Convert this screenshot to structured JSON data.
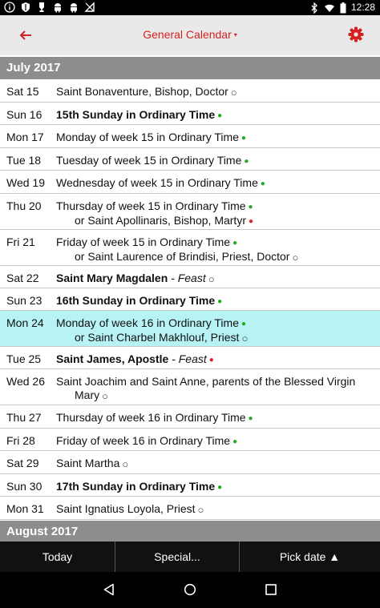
{
  "status_bar": {
    "time": "12:28"
  },
  "header": {
    "title": "General Calendar",
    "caret": "▾"
  },
  "months": [
    {
      "label": "July 2017"
    },
    {
      "label": "August 2017"
    }
  ],
  "days": [
    {
      "date": "Sat 15",
      "lines": [
        {
          "text": "Saint Bonaventure, Bishop, Doctor",
          "bold": false,
          "rank": "",
          "marker": "white"
        }
      ]
    },
    {
      "date": "Sun 16",
      "lines": [
        {
          "text": "15th Sunday in Ordinary Time",
          "bold": true,
          "rank": "",
          "marker": "green"
        }
      ]
    },
    {
      "date": "Mon 17",
      "lines": [
        {
          "text": "Monday of week 15 in Ordinary Time",
          "bold": false,
          "rank": "",
          "marker": "green"
        }
      ]
    },
    {
      "date": "Tue 18",
      "lines": [
        {
          "text": "Tuesday of week 15 in Ordinary Time",
          "bold": false,
          "rank": "",
          "marker": "green"
        }
      ]
    },
    {
      "date": "Wed 19",
      "lines": [
        {
          "text": "Wednesday of week 15 in Ordinary Time",
          "bold": false,
          "rank": "",
          "marker": "green"
        }
      ]
    },
    {
      "date": "Thu 20",
      "lines": [
        {
          "text": "Thursday of week 15 in Ordinary Time",
          "bold": false,
          "rank": "",
          "marker": "green"
        },
        {
          "text": "or Saint Apollinaris, Bishop, Martyr",
          "bold": false,
          "rank": "",
          "marker": "red"
        }
      ]
    },
    {
      "date": "Fri 21",
      "lines": [
        {
          "text": "Friday of week 15 in Ordinary Time",
          "bold": false,
          "rank": "",
          "marker": "green"
        },
        {
          "text": "or Saint Laurence of Brindisi, Priest, Doctor",
          "bold": false,
          "rank": "",
          "marker": "white"
        }
      ]
    },
    {
      "date": "Sat 22",
      "lines": [
        {
          "text": "Saint Mary Magdalen",
          "bold": true,
          "rank": " - Feast",
          "marker": "white"
        }
      ]
    },
    {
      "date": "Sun 23",
      "lines": [
        {
          "text": "16th Sunday in Ordinary Time",
          "bold": true,
          "rank": "",
          "marker": "green"
        }
      ]
    },
    {
      "date": "Mon 24",
      "lines": [
        {
          "text": "Monday of week 16 in Ordinary Time",
          "bold": false,
          "rank": "",
          "marker": "green"
        },
        {
          "text": "or Saint Charbel Makhlouf, Priest",
          "bold": false,
          "rank": "",
          "marker": "white"
        }
      ]
    },
    {
      "date": "Tue 25",
      "lines": [
        {
          "text": "Saint James, Apostle",
          "bold": true,
          "rank": " - Feast",
          "marker": "red"
        }
      ]
    },
    {
      "date": "Wed 26",
      "lines": [
        {
          "text": "Saint Joachim and Saint Anne, parents of the Blessed Virgin",
          "bold": false,
          "rank": "",
          "marker": ""
        },
        {
          "text": "Mary",
          "bold": false,
          "rank": "",
          "marker": "white"
        }
      ]
    },
    {
      "date": "Thu 27",
      "lines": [
        {
          "text": "Thursday of week 16 in Ordinary Time",
          "bold": false,
          "rank": "",
          "marker": "green"
        }
      ]
    },
    {
      "date": "Fri 28",
      "lines": [
        {
          "text": "Friday of week 16 in Ordinary Time",
          "bold": false,
          "rank": "",
          "marker": "green"
        }
      ]
    },
    {
      "date": "Sat 29",
      "lines": [
        {
          "text": "Saint Martha",
          "bold": false,
          "rank": "",
          "marker": "white"
        }
      ]
    },
    {
      "date": "Sun 30",
      "lines": [
        {
          "text": "17th Sunday in Ordinary Time",
          "bold": true,
          "rank": "",
          "marker": "green"
        }
      ]
    },
    {
      "date": "Mon 31",
      "lines": [
        {
          "text": "Saint Ignatius Loyola, Priest",
          "bold": false,
          "rank": "",
          "marker": "white"
        }
      ]
    }
  ],
  "selected_date": "Mon 24",
  "bottom_buttons": {
    "today": "Today",
    "special": "Special...",
    "pick_date": "Pick date ▲"
  },
  "colors": {
    "accent": "#d32222",
    "month_header": "#8d8d8d",
    "highlight": "#b7f3f5",
    "marker_green": "#22aa22",
    "marker_red": "#dd2222",
    "app_bar": "#e9e9e9"
  },
  "icons": {
    "status_left": [
      "info-icon",
      "shield-icon",
      "trophy-icon",
      "android-icon",
      "android-icon",
      "no-sim-icon"
    ],
    "status_right": [
      "bluetooth-icon",
      "wifi-icon",
      "battery-icon"
    ],
    "header": [
      "back-arrow-icon",
      "gear-icon"
    ],
    "nav": [
      "back-triangle-icon",
      "home-circle-icon",
      "recents-square-icon"
    ]
  }
}
